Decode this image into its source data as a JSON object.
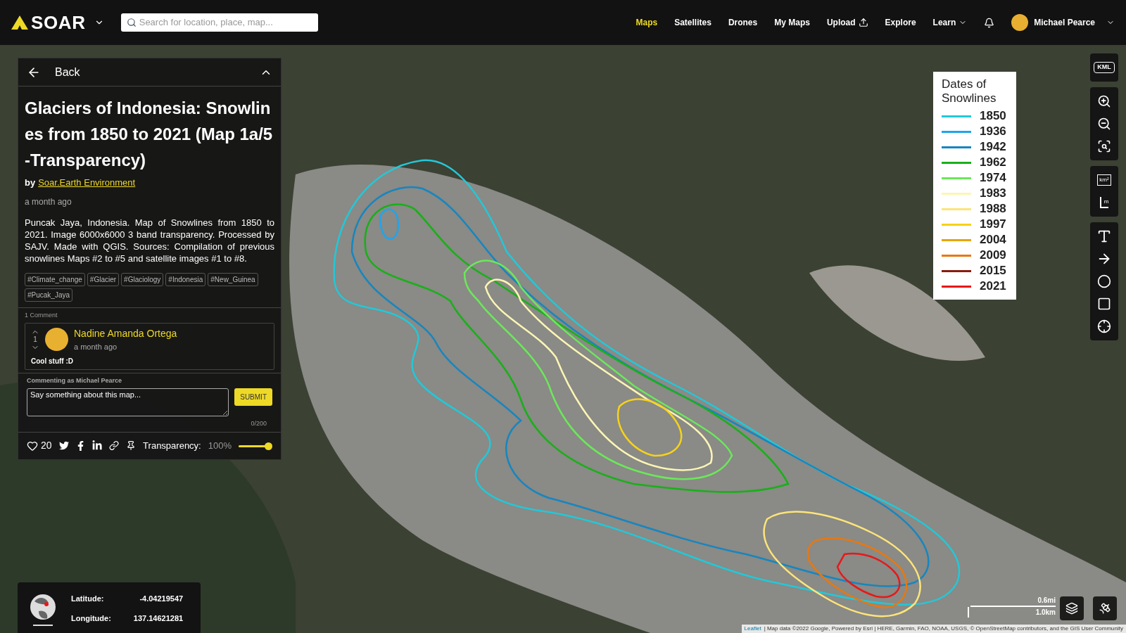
{
  "header": {
    "logo": "SOAR",
    "search": {
      "placeholder": "Search for location, place, map..."
    },
    "nav": [
      {
        "label": "Maps",
        "kind": "link",
        "selected": true
      },
      {
        "label": "Satellites",
        "kind": "link",
        "selected": false
      },
      {
        "label": "Drones",
        "kind": "link",
        "selected": false
      },
      {
        "label": "My Maps",
        "kind": "link",
        "selected": false
      },
      {
        "label": "Upload",
        "kind": "upload",
        "selected": false
      },
      {
        "label": "Explore",
        "kind": "link",
        "selected": false
      },
      {
        "label": "Learn",
        "kind": "dropdown",
        "selected": false
      }
    ],
    "user": "Michael Pearce"
  },
  "panel": {
    "back": "Back",
    "title": "Glaciers of Indonesia: Snowlines from 1850 to 2021 (Map 1a/5-Transparency)",
    "by": "by",
    "author": "Soar.Earth Environment",
    "time": "a month ago",
    "description": "Puncak Jaya, Indonesia. Map of Snowlines from 1850 to 2021. Image 6000x6000 3 band transparency. Processed by SAJV. Made with QGIS. Sources: Compilation of previous snowlines Maps #2 to #5 and satellite images #1 to #8.",
    "tags": [
      "#Climate_change",
      "#Glacier",
      "#Glaciology",
      "#Indonesia",
      "#New_Guinea",
      "#Pucak_Jaya"
    ],
    "comments_count": "1 Comment",
    "comments": [
      {
        "author": "Nadine Amanda Ortega",
        "time": "a month ago",
        "votes": "1",
        "text": "Cool stuff :D"
      }
    ],
    "commenting_as": "Commenting as Michael Pearce",
    "comment_field": {
      "placeholder": "Say something about this map..."
    },
    "submit": "SUBMIT",
    "counter": "0/200",
    "likes": "20",
    "transparency": {
      "label": "Transparency:",
      "value": "100%",
      "level": 1
    }
  },
  "legend": {
    "title": "Dates of Snowlines",
    "items": [
      {
        "label": "1850",
        "color": "#22c8d8"
      },
      {
        "label": "1936",
        "color": "#1ea5ec"
      },
      {
        "label": "1942",
        "color": "#1686c0"
      },
      {
        "label": "1962",
        "color": "#18b018"
      },
      {
        "label": "1974",
        "color": "#6be85a"
      },
      {
        "label": "1983",
        "color": "#fbf6b4"
      },
      {
        "label": "1988",
        "color": "#fde47a"
      },
      {
        "label": "1997",
        "color": "#f5d21a"
      },
      {
        "label": "2004",
        "color": "#e6a600"
      },
      {
        "label": "2009",
        "color": "#e87810"
      },
      {
        "label": "2015",
        "color": "#8a1a10"
      },
      {
        "label": "2021",
        "color": "#e81818"
      }
    ]
  },
  "tools": [
    [
      {
        "kind": "kml",
        "label": "KML"
      }
    ],
    [
      {
        "kind": "zoom-in"
      },
      {
        "kind": "zoom-out"
      },
      {
        "kind": "zoom-fit"
      }
    ],
    [
      {
        "kind": "area",
        "label": "km²"
      },
      {
        "kind": "distance",
        "label": "m"
      }
    ],
    [
      {
        "kind": "text"
      },
      {
        "kind": "arrow"
      },
      {
        "kind": "circle"
      },
      {
        "kind": "rectangle"
      },
      {
        "kind": "locate"
      }
    ]
  ],
  "coordinates": {
    "latitude_label": "Latitude:",
    "latitude": "-4.04219547",
    "longitude_label": "Longitude:",
    "longitude": "137.14621281"
  },
  "scale": {
    "miles": "0.6mi",
    "km": "1.0km"
  },
  "attribution": {
    "link": "Leaflet",
    "text": "| Map data ©2022 Google, Powered by Esri | HERE, Garmin, FAO, NOAA, USGS, © OpenStreetMap contributors, and the GIS User Community"
  }
}
